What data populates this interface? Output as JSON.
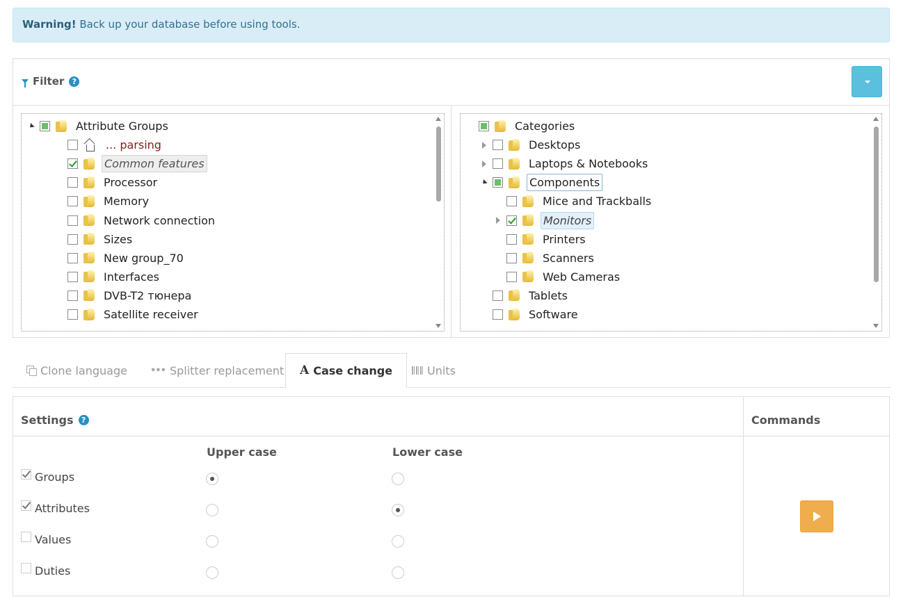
{
  "alert": {
    "strong": "Warning!",
    "text": " Back up your database before using tools."
  },
  "filter": {
    "title": "Filter",
    "help": "?"
  },
  "attribute_tree": [
    {
      "label": "Attribute Groups",
      "level": 0,
      "toggle": "open",
      "check": "partial",
      "icon": "folder-icon",
      "style": ""
    },
    {
      "label": "... parsing",
      "level": 1,
      "toggle": "",
      "check": "none",
      "icon": "home-icon",
      "style": "red"
    },
    {
      "label": "Common features",
      "level": 1,
      "toggle": "",
      "check": "checked",
      "icon": "folder-icon",
      "style": "sel-grey"
    },
    {
      "label": "Processor",
      "level": 1,
      "toggle": "",
      "check": "none",
      "icon": "folder-icon",
      "style": ""
    },
    {
      "label": "Memory",
      "level": 1,
      "toggle": "",
      "check": "none",
      "icon": "folder-icon",
      "style": ""
    },
    {
      "label": "Network connection",
      "level": 1,
      "toggle": "",
      "check": "none",
      "icon": "folder-icon",
      "style": ""
    },
    {
      "label": "Sizes",
      "level": 1,
      "toggle": "",
      "check": "none",
      "icon": "folder-icon",
      "style": ""
    },
    {
      "label": "New group_70",
      "level": 1,
      "toggle": "",
      "check": "none",
      "icon": "folder-icon",
      "style": ""
    },
    {
      "label": "Interfaces",
      "level": 1,
      "toggle": "",
      "check": "none",
      "icon": "folder-icon",
      "style": ""
    },
    {
      "label": "DVB-T2 тюнера",
      "level": 1,
      "toggle": "",
      "check": "none",
      "icon": "folder-icon",
      "style": ""
    },
    {
      "label": "Satellite receiver",
      "level": 1,
      "toggle": "",
      "check": "none",
      "icon": "folder-icon",
      "style": ""
    }
  ],
  "category_tree": [
    {
      "label": "Categories",
      "level": 0,
      "toggle": "",
      "check": "partial",
      "icon": "folder-icon",
      "style": ""
    },
    {
      "label": "Desktops",
      "level": 1,
      "toggle": "closed",
      "check": "none",
      "icon": "folder-icon",
      "style": ""
    },
    {
      "label": "Laptops & Notebooks",
      "level": 1,
      "toggle": "closed",
      "check": "none",
      "icon": "folder-icon",
      "style": ""
    },
    {
      "label": "Components",
      "level": 1,
      "toggle": "open",
      "check": "partial",
      "icon": "folder-icon",
      "style": "boxed"
    },
    {
      "label": "Mice and Trackballs",
      "level": 2,
      "toggle": "",
      "check": "none",
      "icon": "folder-icon",
      "style": ""
    },
    {
      "label": "Monitors",
      "level": 2,
      "toggle": "closed",
      "check": "checked",
      "icon": "folder-icon",
      "style": "sel-blue"
    },
    {
      "label": "Printers",
      "level": 2,
      "toggle": "",
      "check": "none",
      "icon": "folder-icon",
      "style": ""
    },
    {
      "label": "Scanners",
      "level": 2,
      "toggle": "",
      "check": "none",
      "icon": "folder-icon",
      "style": ""
    },
    {
      "label": "Web Cameras",
      "level": 2,
      "toggle": "",
      "check": "none",
      "icon": "folder-icon",
      "style": ""
    },
    {
      "label": "Tablets",
      "level": 1,
      "toggle": "",
      "check": "none",
      "icon": "folder-icon",
      "style": ""
    },
    {
      "label": "Software",
      "level": 1,
      "toggle": "",
      "check": "none",
      "icon": "folder-icon",
      "style": ""
    }
  ],
  "tabs": [
    {
      "label": "Clone language",
      "icon": "clone-icon",
      "active": false
    },
    {
      "label": "Splitter replacement",
      "icon": "dots-icon",
      "active": false
    },
    {
      "label": "Case change",
      "icon": "font-icon",
      "active": true
    },
    {
      "label": "Units",
      "icon": "barcode-icon",
      "active": false
    }
  ],
  "settings": {
    "title": "Settings",
    "help": "?",
    "commands_title": "Commands",
    "upper_label": "Upper case",
    "lower_label": "Lower case",
    "rows": [
      {
        "label": "Groups",
        "checked": true,
        "case": "upper"
      },
      {
        "label": "Attributes",
        "checked": true,
        "case": "lower"
      },
      {
        "label": "Values",
        "checked": false,
        "case": ""
      },
      {
        "label": "Duties",
        "checked": false,
        "case": ""
      }
    ]
  },
  "colors": {
    "alert_bg": "#d9edf7",
    "info_button": "#5bc0de",
    "warning_button": "#f0ad4e",
    "accent": "#2a8fc4"
  }
}
